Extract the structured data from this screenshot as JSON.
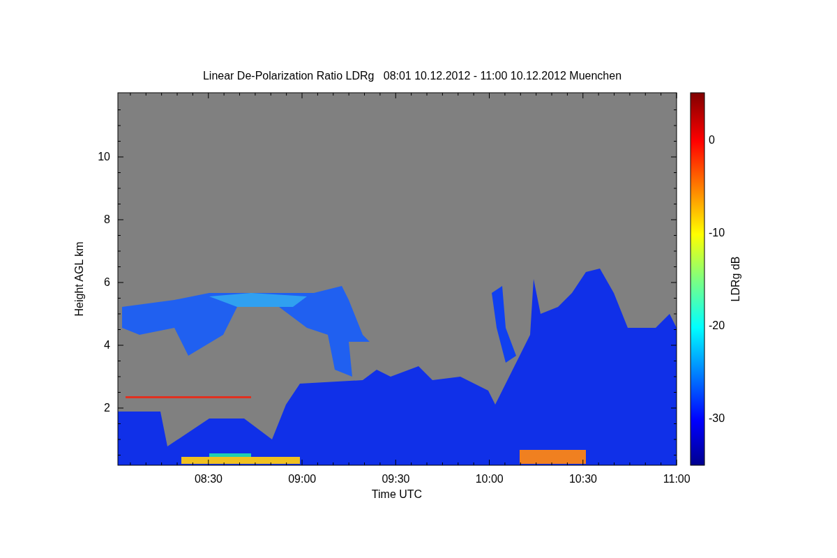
{
  "title": "Linear De-Polarization Ratio LDRg   08:01 10.12.2012 - 11:00 10.12.2012 Muenchen",
  "xlabel": "Time UTC",
  "ylabel": "Height AGL km",
  "xticks": [
    "08:30",
    "09:00",
    "09:30",
    "10:00",
    "10:30",
    "11:00"
  ],
  "yticks": [
    "10",
    "8",
    "6",
    "4",
    "2"
  ],
  "colorbar": {
    "label": "LDRg dB",
    "ticks": [
      "0",
      "-10",
      "-20",
      "-30"
    ]
  }
}
